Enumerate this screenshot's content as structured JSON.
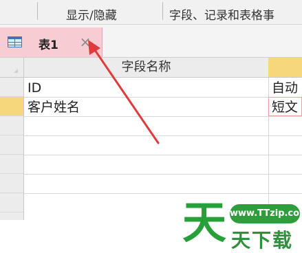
{
  "ribbon": {
    "groups": [
      {
        "label": "显示/隐藏"
      },
      {
        "label": "字段、记录和表格事"
      }
    ]
  },
  "document_tab": {
    "title": "表1",
    "close_glyph": "×",
    "icon": "table-icon"
  },
  "grid": {
    "columns": [
      "字段名称",
      ""
    ],
    "rows": [
      {
        "field_name": "ID",
        "data_type": "自动"
      },
      {
        "field_name": "客户姓名",
        "data_type": "短文"
      }
    ],
    "selected_row_index": 1
  },
  "watermark": {
    "big_char": "天",
    "badge": "www.TTzip.com",
    "subtitle": "天下载"
  },
  "colors": {
    "tab_background": "#f7cdd3",
    "selection_highlight": "#f7d77b",
    "arrow": "#e03a3a",
    "watermark_green": "#27a03a"
  }
}
